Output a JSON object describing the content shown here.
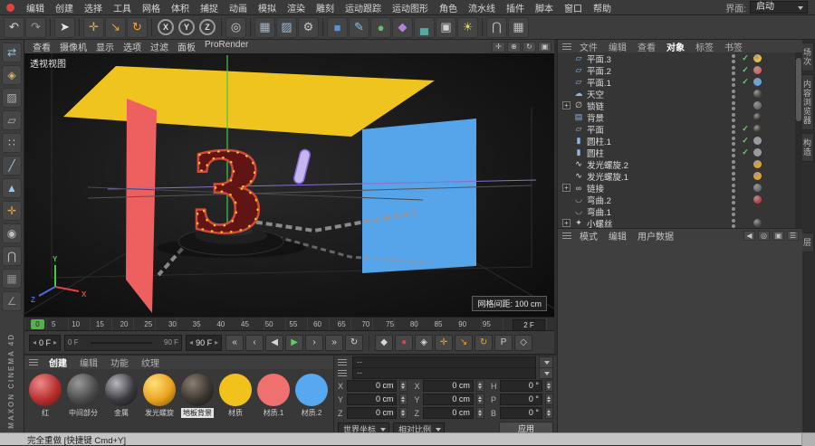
{
  "window": {
    "status_text": "完全重做 [快捷键 Cmd+Y]",
    "brand": "MAXON CINEMA 4D"
  },
  "menubar": {
    "items": [
      "编辑",
      "创建",
      "选择",
      "工具",
      "网格",
      "体积",
      "捕捉",
      "动画",
      "模拟",
      "渲染",
      "雕刻",
      "运动跟踪",
      "运动图形",
      "角色",
      "流水线",
      "插件",
      "脚本",
      "窗口",
      "帮助"
    ],
    "interface_label": "界面:",
    "interface_value": "启动"
  },
  "toolbar": {
    "groups": [
      [
        {
          "name": "undo-icon",
          "glyph": "↶",
          "color": "#d8d8d8"
        },
        {
          "name": "redo-icon",
          "glyph": "↷",
          "color": "#9a9a9a"
        }
      ],
      [
        {
          "name": "live-selection-icon",
          "glyph": "➤",
          "color": "#e8e8e8"
        }
      ],
      [
        {
          "name": "move-tool-icon",
          "glyph": "✛",
          "color": "#e8a33d"
        },
        {
          "name": "scale-tool-icon",
          "glyph": "↘",
          "color": "#e8a33d"
        },
        {
          "name": "rotate-tool-icon",
          "glyph": "↻",
          "color": "#e8a33d"
        }
      ],
      [
        {
          "name": "x-axis-lock-icon",
          "glyph": "X",
          "shape": "circle"
        },
        {
          "name": "y-axis-lock-icon",
          "glyph": "Y",
          "shape": "circle"
        },
        {
          "name": "z-axis-lock-icon",
          "glyph": "Z",
          "shape": "circle"
        }
      ],
      [
        {
          "name": "coordinate-system-icon",
          "glyph": "◎",
          "color": "#d0d0d0"
        }
      ],
      [
        {
          "name": "render-view-icon",
          "glyph": "▦",
          "color": "#9ab8d8"
        },
        {
          "name": "render-picture-viewer-icon",
          "glyph": "▨",
          "color": "#9ab8d8"
        },
        {
          "name": "render-settings-icon",
          "glyph": "⚙",
          "color": "#c8c8c8"
        }
      ],
      [
        {
          "name": "add-cube-icon",
          "glyph": "■",
          "color": "#5b8fd6"
        },
        {
          "name": "add-spline-icon",
          "glyph": "✎",
          "color": "#7ec3e8"
        },
        {
          "name": "add-generator-icon",
          "glyph": "●",
          "color": "#69bd69"
        },
        {
          "name": "add-deformer-icon",
          "glyph": "◆",
          "color": "#b184dc"
        },
        {
          "name": "add-environment-icon",
          "glyph": "▄",
          "color": "#57a8a0"
        },
        {
          "name": "add-camera-icon",
          "glyph": "▣",
          "color": "#cfcfcf"
        },
        {
          "name": "add-light-icon",
          "glyph": "☀",
          "color": "#e8d44a"
        }
      ],
      [
        {
          "name": "snap-toggle-icon",
          "glyph": "⋂",
          "color": "#c0c0c0"
        },
        {
          "name": "workplane-toggle-icon",
          "glyph": "▦",
          "color": "#c0c0c0"
        }
      ]
    ]
  },
  "left_toolbar": {
    "icons": [
      {
        "name": "convert-editable-icon",
        "glyph": "⇄",
        "color": "#8fc8e8"
      },
      {
        "name": "model-mode-icon",
        "glyph": "◈",
        "color": "#d8b06a"
      },
      {
        "name": "texture-mode-icon",
        "glyph": "▨",
        "color": "#b0b0b0"
      },
      {
        "name": "workplane-mode-icon",
        "glyph": "▱",
        "color": "#b0b0b0"
      },
      {
        "name": "points-mode-icon",
        "glyph": "∷",
        "color": "#9ac8e8"
      },
      {
        "name": "edges-mode-icon",
        "glyph": "╱",
        "color": "#9ac8e8"
      },
      {
        "name": "polygons-mode-icon",
        "glyph": "▲",
        "color": "#9ac8e8"
      },
      {
        "name": "enable-axis-icon",
        "glyph": "✛",
        "color": "#e8a33d"
      },
      {
        "name": "viewport-solo-icon",
        "glyph": "◉",
        "color": "#c0c0c0"
      },
      {
        "name": "enable-snap-icon",
        "glyph": "⋂",
        "color": "#c0c0c0"
      },
      {
        "name": "locked-workplane-icon",
        "glyph": "▦",
        "color": "#909090"
      },
      {
        "name": "quantize-icon",
        "glyph": "∠",
        "color": "#909090"
      }
    ]
  },
  "viewport": {
    "menus": [
      "查看",
      "摄像机",
      "显示",
      "选项",
      "过滤",
      "面板",
      "ProRender"
    ],
    "nav_icons": [
      {
        "name": "view-pan-icon",
        "glyph": "✛"
      },
      {
        "name": "view-zoom-icon",
        "glyph": "⊕"
      },
      {
        "name": "view-rotate-icon",
        "glyph": "↻"
      },
      {
        "name": "view-toggle-icon",
        "glyph": "▣"
      }
    ],
    "view_label": "透视视图",
    "grid_label": "网格间距: 100 cm",
    "numeral": "3",
    "axis_labels": {
      "x": "X",
      "y": "Y",
      "z": "Z"
    },
    "colors": {
      "ceiling": "#f0c41e",
      "left_wall": "#ee5f5f",
      "right_wall": "#56a4ea",
      "numeral_face": "#611414",
      "numeral_edge": "#d44a3a",
      "bulbs": "#f5c518",
      "capsule": "#c6b5ef",
      "capsule_edge": "#8568d8",
      "chain": "#969696",
      "axis_x": "#e04545",
      "axis_y": "#46c846",
      "axis_z": "#4a6ae0",
      "pedestal": "#141414",
      "guide": "#8a6fd0"
    }
  },
  "timeline": {
    "marker_label": "0",
    "ticks": [
      "5",
      "10",
      "15",
      "20",
      "25",
      "30",
      "35",
      "40",
      "45",
      "50",
      "55",
      "60",
      "65",
      "70",
      "75",
      "80",
      "85",
      "90",
      "95"
    ],
    "end_frame_label": "2 F"
  },
  "transport": {
    "current_value": "0 F",
    "range_start": "0 F",
    "range_end": "90 F",
    "max_value": "90 F",
    "buttons": [
      {
        "name": "goto-start-button",
        "glyph": "«"
      },
      {
        "name": "prev-key-button",
        "glyph": "‹"
      },
      {
        "name": "prev-frame-button",
        "glyph": "◀"
      },
      {
        "name": "play-button",
        "glyph": "▶",
        "color": "#5cd05c"
      },
      {
        "name": "next-frame-button",
        "glyph": "›"
      },
      {
        "name": "goto-end-button",
        "glyph": "»"
      },
      {
        "name": "loop-button",
        "glyph": "↻"
      }
    ],
    "record_buttons": [
      {
        "name": "record-keyframe-button",
        "glyph": "◆",
        "color": "#d8d8d8"
      },
      {
        "name": "autokey-button",
        "glyph": "●",
        "color": "#d84545"
      },
      {
        "name": "keyframe-selection-button",
        "glyph": "◈",
        "color": "#d8d8d8"
      },
      {
        "name": "record-position-button",
        "glyph": "✛",
        "color": "#e8a33d"
      },
      {
        "name": "record-scale-button",
        "glyph": "↘",
        "color": "#e8a33d"
      },
      {
        "name": "record-rotation-button",
        "glyph": "↻",
        "color": "#e8a33d"
      },
      {
        "name": "record-parameter-button",
        "glyph": "P",
        "color": "#d0d0d0"
      },
      {
        "name": "record-pla-button",
        "glyph": "◇",
        "color": "#d0d0d0"
      }
    ]
  },
  "materials": {
    "tabs": [
      {
        "label": "创建",
        "active": true
      },
      {
        "label": "编辑",
        "active": false
      },
      {
        "label": "功能",
        "active": false
      },
      {
        "label": "纹理",
        "active": false
      }
    ],
    "items": [
      {
        "label": "红",
        "base": "#b52f2f",
        "hi": "#ef8a8a",
        "dark": "#5a1010"
      },
      {
        "label": "中间部分",
        "base": "#4a4a4a",
        "hi": "#9a9a9a",
        "dark": "#1c1c1c"
      },
      {
        "label": "金属",
        "base": "#3a3a3e",
        "hi": "#b8b8c0",
        "dark": "#121214"
      },
      {
        "label": "发光螺旋",
        "base": "#e8a21f",
        "hi": "#ffe07a",
        "dark": "#7a4a08"
      },
      {
        "label": "地板背景",
        "base": "#3c3631",
        "hi": "#8a7f72",
        "dark": "#15100c",
        "selected": true
      },
      {
        "label": "材质",
        "base": "#f2c21c",
        "flat": true
      },
      {
        "label": "材质.1",
        "base": "#f07070",
        "flat": true
      },
      {
        "label": "材质.2",
        "base": "#58a8f0",
        "flat": true
      }
    ]
  },
  "coordinates": {
    "header_fields": [
      "--",
      "--"
    ],
    "position": {
      "labels": [
        "X",
        "Y",
        "Z"
      ],
      "values": [
        "0 cm",
        "0 cm",
        "0 cm"
      ]
    },
    "size": {
      "labels": [
        "X",
        "Y",
        "Z"
      ],
      "values": [
        "0 cm",
        "0 cm",
        "0 cm"
      ]
    },
    "rotation": {
      "labels": [
        "H",
        "P",
        "B"
      ],
      "values": [
        "0 °",
        "0 °",
        "0 °"
      ]
    },
    "coord_dropdown": "世界坐标",
    "scale_dropdown": "相对比例",
    "apply_label": "应用"
  },
  "object_manager": {
    "tabs": [
      {
        "label": "文件",
        "active": false
      },
      {
        "label": "编辑",
        "active": false
      },
      {
        "label": "查看",
        "active": false
      },
      {
        "label": "对象",
        "active": true
      },
      {
        "label": "标签",
        "active": false
      },
      {
        "label": "书签",
        "active": false
      }
    ],
    "items": [
      {
        "name": "平面.3",
        "icon": "plane",
        "expand": false,
        "check": true,
        "tags": [
          "#e9c23c"
        ]
      },
      {
        "name": "平面.2",
        "icon": "plane",
        "expand": false,
        "check": true,
        "tags": [
          "#e06060"
        ]
      },
      {
        "name": "平面.1",
        "icon": "plane",
        "expand": false,
        "check": true,
        "tags": [
          "#5aa7e8"
        ]
      },
      {
        "name": "天空",
        "icon": "sky",
        "expand": false,
        "check": false,
        "tags": [
          "#4a4a4a"
        ]
      },
      {
        "name": "锁链",
        "icon": "null",
        "expand": true,
        "check": false,
        "tags": [
          "#6a6a72"
        ]
      },
      {
        "name": "背景",
        "icon": "background",
        "expand": false,
        "check": false,
        "tags": [
          "#35302b"
        ]
      },
      {
        "name": "平面",
        "icon": "plane",
        "expand": false,
        "check": true,
        "tags": [
          "#3c3631"
        ]
      },
      {
        "name": "圆柱.1",
        "icon": "cylinder",
        "expand": false,
        "check": true,
        "tags": [
          "#9a9aa2"
        ]
      },
      {
        "name": "圆柱",
        "icon": "cylinder",
        "expand": false,
        "check": true,
        "tags": [
          "#9a9aa2"
        ]
      },
      {
        "name": "发光螺旋.2",
        "icon": "spline",
        "expand": false,
        "check": false,
        "tags": [
          "#e8a21f"
        ]
      },
      {
        "name": "发光螺旋.1",
        "icon": "spline",
        "expand": false,
        "check": false,
        "tags": [
          "#e8a21f"
        ]
      },
      {
        "name": "链接",
        "icon": "link",
        "expand": true,
        "check": false,
        "tags": [
          "#6a6a72"
        ]
      },
      {
        "name": "弯曲.2",
        "icon": "bend",
        "expand": false,
        "check": false,
        "tags": [
          "#c04040"
        ]
      },
      {
        "name": "弯曲.1",
        "icon": "bend",
        "expand": false,
        "check": false,
        "tags": []
      },
      {
        "name": "小螺丝",
        "icon": "screw",
        "expand": true,
        "check": false,
        "tags": [
          "#4a4a4a"
        ]
      }
    ]
  },
  "mode_panel": {
    "tabs": [
      "模式",
      "编辑",
      "用户数据"
    ],
    "icons": [
      {
        "name": "nav-back-icon",
        "glyph": "◀"
      },
      {
        "name": "search-icon",
        "glyph": "◎"
      },
      {
        "name": "lock-icon",
        "glyph": "▣"
      },
      {
        "name": "panel-menu-icon",
        "glyph": "☰"
      }
    ]
  },
  "right_tabs": {
    "top": [
      "场次",
      "内容浏览器",
      "构造"
    ],
    "bottom": [
      "层"
    ]
  }
}
